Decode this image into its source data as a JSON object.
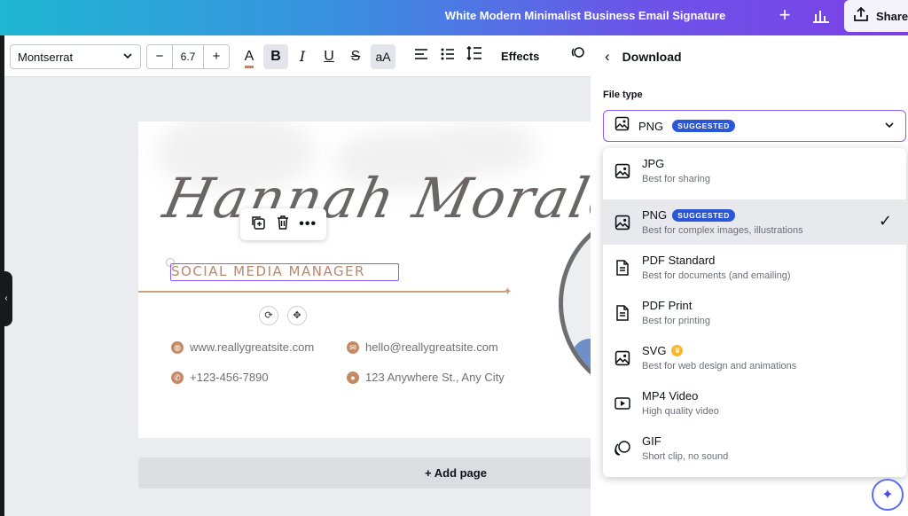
{
  "header": {
    "title": "White Modern Minimalist Business Email Signature",
    "share_label": "Share",
    "plus_icon": "plus-icon",
    "insights_icon": "bar-chart-icon"
  },
  "toolbar": {
    "font": "Montserrat",
    "size_minus": "−",
    "size_value": "6.7",
    "size_plus": "+",
    "text_color_glyph": "A",
    "bold_glyph": "B",
    "italic_glyph": "I",
    "underline_glyph": "U",
    "strike_glyph": "S",
    "case_glyph": "aA",
    "effects_label": "Effects",
    "text_color": "#b9886b"
  },
  "canvas": {
    "script_name": "Hannah Morales",
    "role": "SOCIAL MEDIA MANAGER",
    "contacts": [
      {
        "icon": "globe-icon",
        "text": "www.reallygreatsite.com"
      },
      {
        "icon": "mail-icon",
        "text": "hello@reallygreatsite.com"
      },
      {
        "icon": "phone-icon",
        "text": "+123-456-7890"
      },
      {
        "icon": "location-pin-icon",
        "text": "123 Anywhere St., Any City"
      }
    ],
    "accent_color": "#c48a66"
  },
  "add_page_label": "+ Add page",
  "panel": {
    "back_glyph": "‹",
    "title": "Download",
    "file_type_label": "File type",
    "selected": {
      "name": "PNG",
      "badge": "SUGGESTED"
    },
    "options": [
      {
        "name": "JPG",
        "desc": "Best for sharing",
        "icon": "image-icon"
      },
      {
        "name": "PNG",
        "badge": "SUGGESTED",
        "desc": "Best for complex images, illustrations",
        "icon": "image-icon",
        "selected": true
      },
      {
        "name": "PDF Standard",
        "desc": "Best for documents (and emailing)",
        "icon": "document-icon"
      },
      {
        "name": "PDF Print",
        "desc": "Best for printing",
        "icon": "document-icon"
      },
      {
        "name": "SVG",
        "desc": "Best for web design and animations",
        "icon": "image-icon",
        "pro": true
      },
      {
        "name": "MP4 Video",
        "desc": "High quality video",
        "icon": "video-icon"
      },
      {
        "name": "GIF",
        "desc": "Short clip, no sound",
        "icon": "gif-icon"
      }
    ],
    "accent_color": "#8b5cf6",
    "badge_color": "#2b56d8"
  }
}
